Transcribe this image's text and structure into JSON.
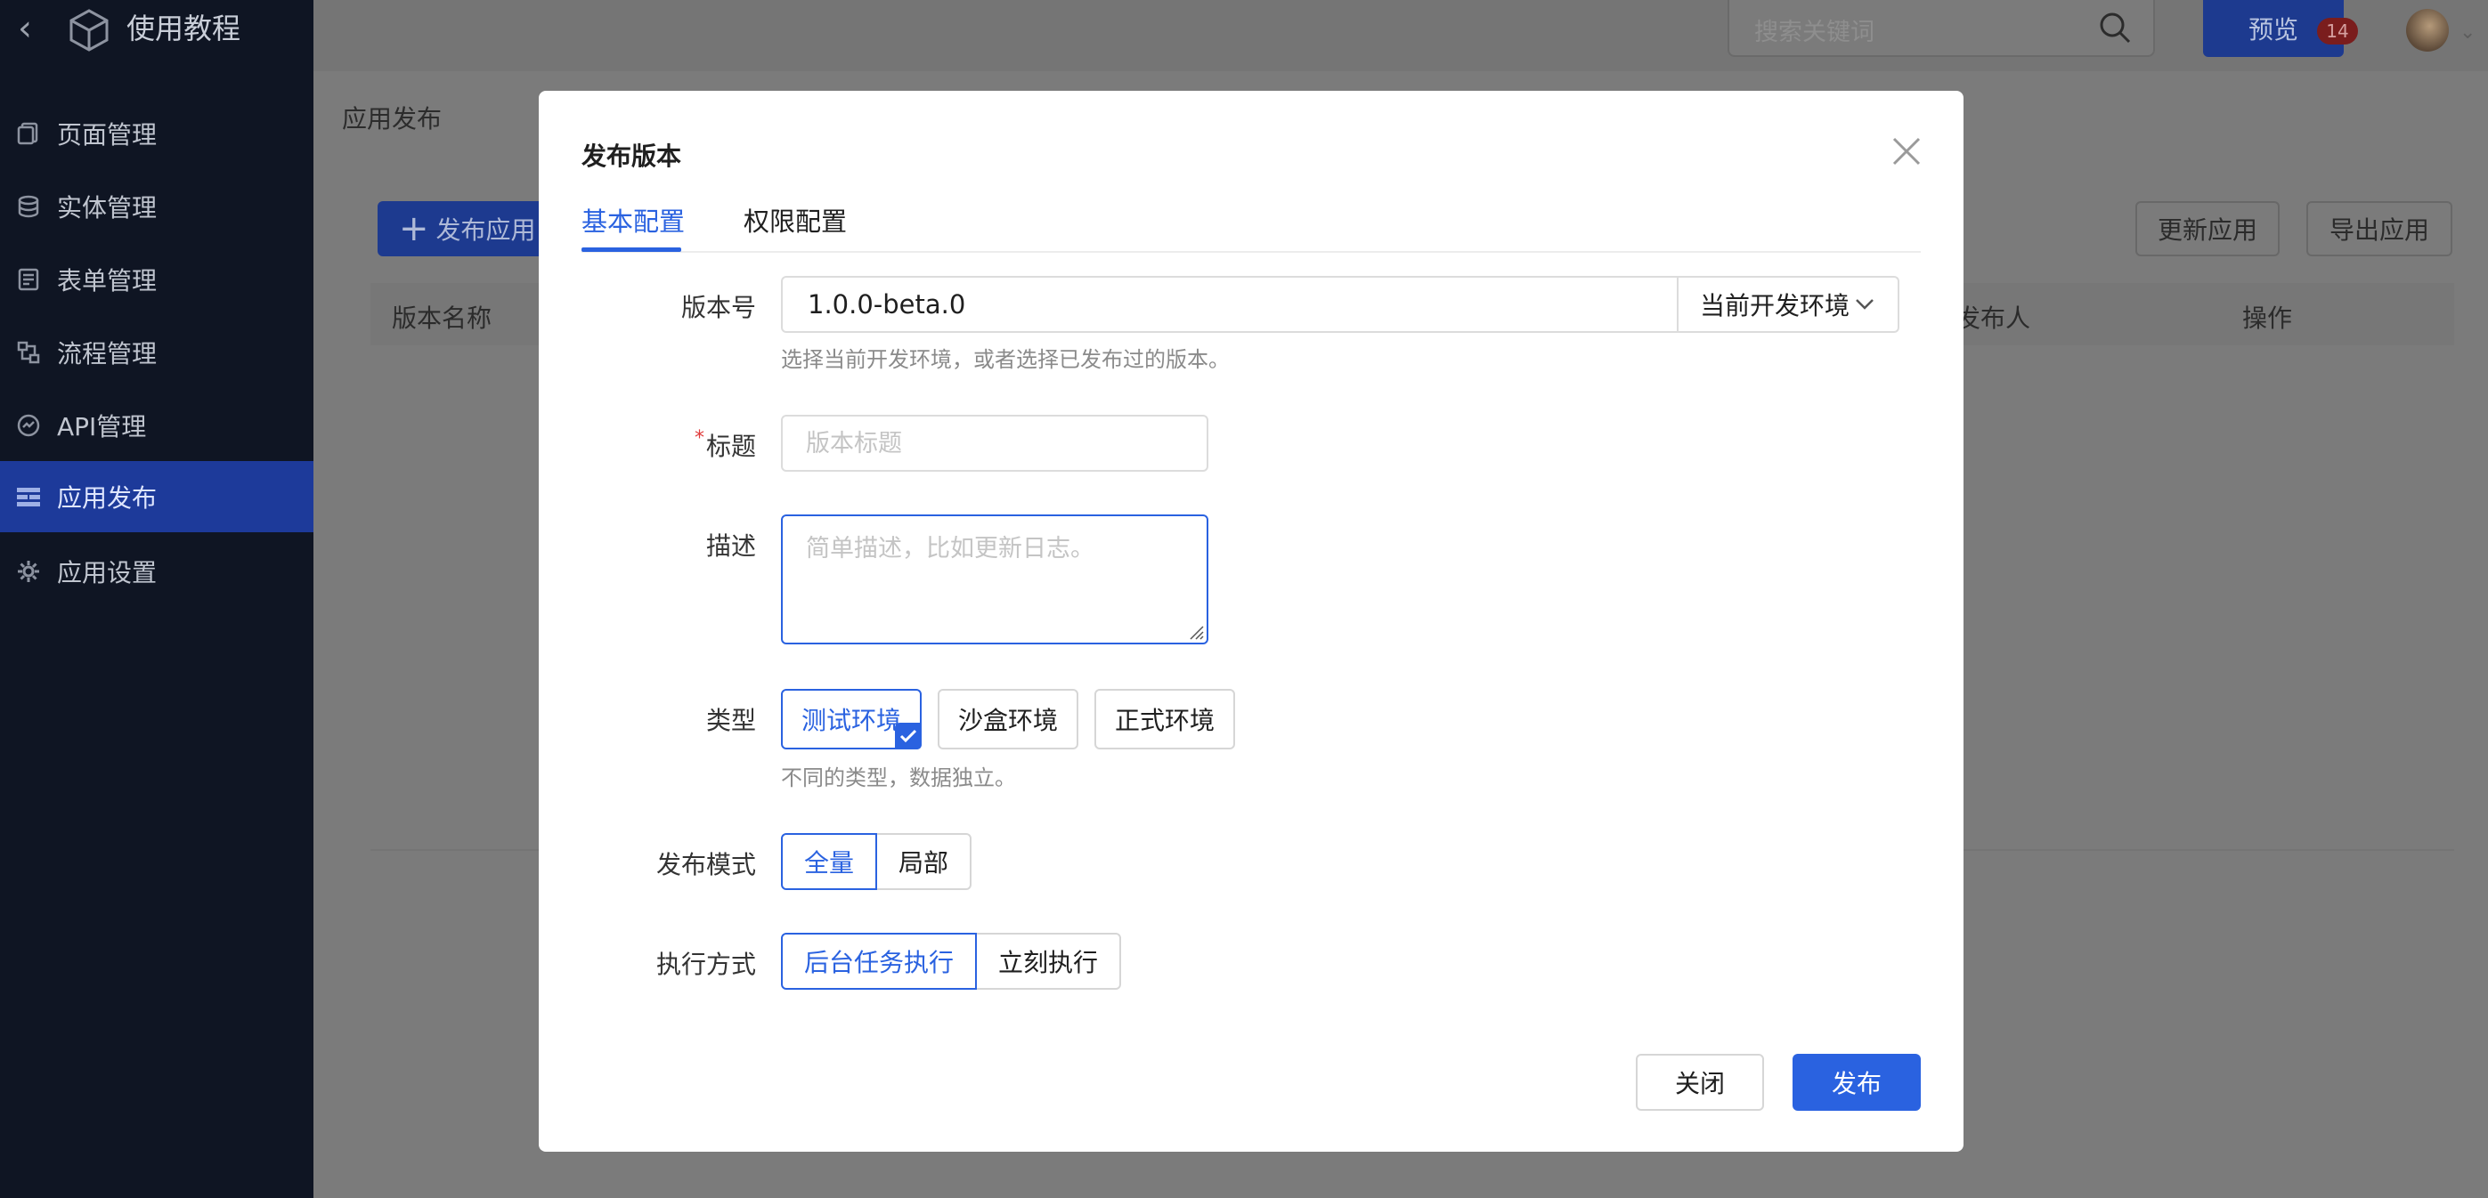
{
  "colors": {
    "accent": "#2a62e0",
    "sidebar_bg": "#0f1523",
    "sidebar_active": "#1d3a9a",
    "required": "#e03b3b"
  },
  "sidebar": {
    "back_icon": "chevron-left-icon",
    "logo_icon": "cube-icon",
    "title": "使用教程",
    "items": [
      {
        "label": "页面管理",
        "icon": "page-icon"
      },
      {
        "label": "实体管理",
        "icon": "database-icon"
      },
      {
        "label": "表单管理",
        "icon": "form-icon"
      },
      {
        "label": "流程管理",
        "icon": "flow-icon"
      },
      {
        "label": "API管理",
        "icon": "api-icon"
      },
      {
        "label": "应用发布",
        "icon": "publish-icon",
        "active": true
      },
      {
        "label": "应用设置",
        "icon": "gear-icon"
      }
    ]
  },
  "topbar": {
    "search_placeholder": "搜索关键词",
    "search_icon": "search-icon",
    "preview_label": "预览",
    "notification_count": "14"
  },
  "page": {
    "title": "应用发布",
    "publish_app_label": "发布应用",
    "update_app_label": "更新应用",
    "export_app_label": "导出应用",
    "table_columns": [
      "版本名称",
      "发布人",
      "操作"
    ]
  },
  "modal": {
    "title": "发布版本",
    "tabs": [
      "基本配置",
      "权限配置"
    ],
    "version": {
      "label": "版本号",
      "value": "1.0.0-beta.0",
      "selector": "当前开发环境",
      "hint": "选择当前开发环境，或者选择已发布过的版本。"
    },
    "title_field": {
      "label": "标题",
      "required_mark": "*",
      "placeholder": "版本标题"
    },
    "description": {
      "label": "描述",
      "placeholder": "简单描述，比如更新日志。"
    },
    "type": {
      "label": "类型",
      "options": [
        "测试环境",
        "沙盒环境",
        "正式环境"
      ],
      "selected": "测试环境",
      "hint": "不同的类型，数据独立。"
    },
    "mode": {
      "label": "发布模式",
      "options": [
        "全量",
        "局部"
      ],
      "selected": "全量"
    },
    "execution": {
      "label": "执行方式",
      "options": [
        "后台任务执行",
        "立刻执行"
      ],
      "selected": "后台任务执行"
    },
    "close_label": "关闭",
    "publish_label": "发布"
  }
}
